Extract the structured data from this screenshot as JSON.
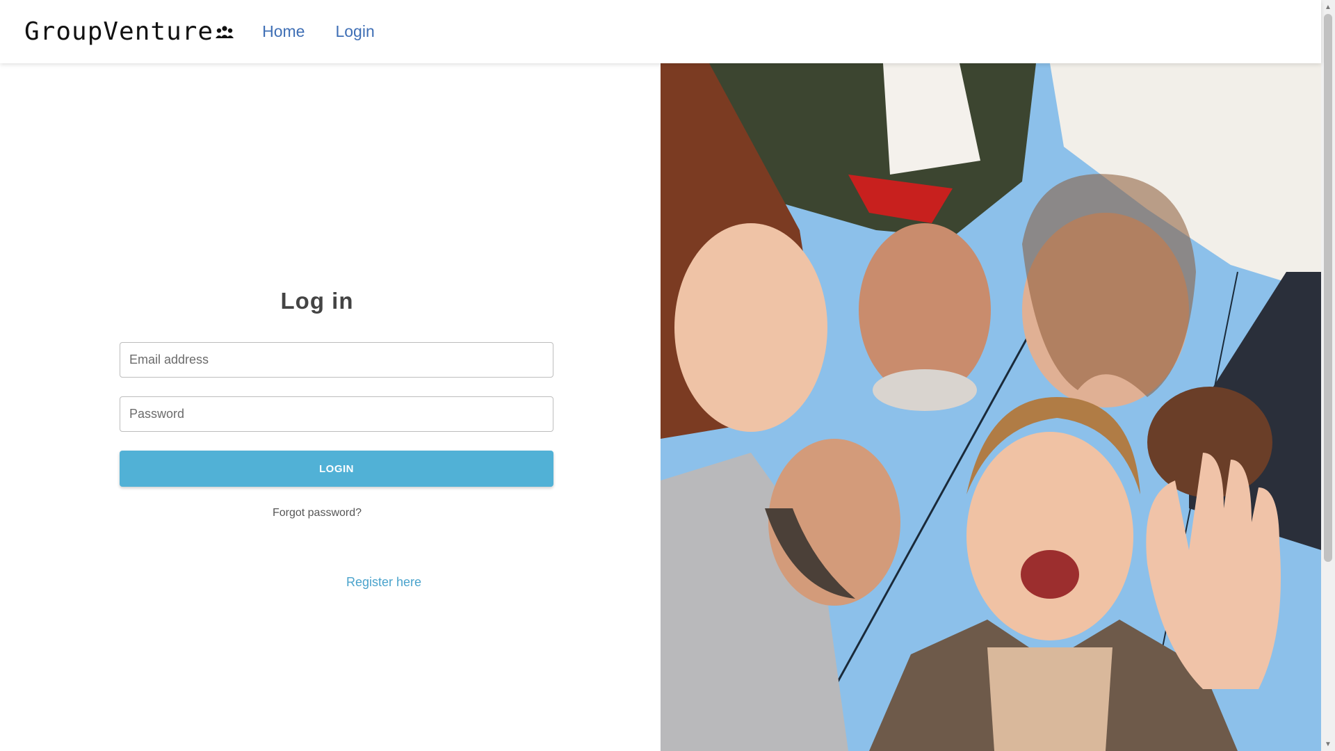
{
  "navbar": {
    "brand": "GroupVenture",
    "brand_icon": "people-group-icon",
    "links": [
      {
        "label": "Home"
      },
      {
        "label": "Login"
      }
    ]
  },
  "login": {
    "title": "Log in",
    "email_placeholder": "Email address",
    "password_placeholder": "Password",
    "submit_label": "LOGIN",
    "forgot_label": "Forgot password?",
    "register_label": "Register here"
  },
  "hero": {
    "description_icon": "group-selfie-photo"
  },
  "colors": {
    "accent": "#51b1d6",
    "link": "#3f6fb5",
    "register_link": "#4aa3cc"
  }
}
